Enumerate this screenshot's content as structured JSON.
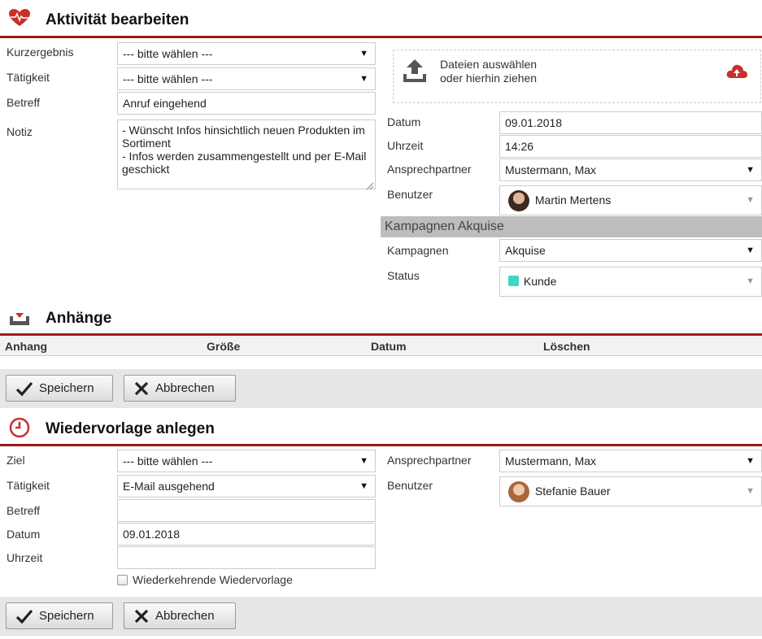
{
  "activity": {
    "title": "Aktivität bearbeiten",
    "labels": {
      "kurzergebnis": "Kurzergebnis",
      "taetigkeit": "Tätigkeit",
      "betreff": "Betreff",
      "notiz": "Notiz",
      "datum": "Datum",
      "uhrzeit": "Uhrzeit",
      "ansprechpartner": "Ansprechpartner",
      "benutzer": "Benutzer",
      "kampagnen": "Kampagnen",
      "status": "Status"
    },
    "values": {
      "kurzergebnis": "--- bitte wählen ---",
      "taetigkeit": "--- bitte wählen ---",
      "betreff": "Anruf eingehend",
      "notiz": "- Wünscht Infos hinsichtlich neuen Produkten im Sortiment\n- Infos werden zusammengestellt und per E-Mail geschickt",
      "datum": "09.01.2018",
      "uhrzeit": "14:26",
      "ansprechpartner": "Mustermann, Max",
      "benutzer": "Martin Mertens",
      "kampagnen": "Akquise",
      "status": "Kunde"
    },
    "upload": {
      "line1": "Dateien auswählen",
      "line2": "oder hierhin ziehen"
    },
    "campaign_header": "Kampagnen Akquise",
    "status_color": "#3ed6c4"
  },
  "attachments": {
    "title": "Anhänge",
    "columns": [
      "Anhang",
      "Größe",
      "Datum",
      "Löschen"
    ]
  },
  "buttons": {
    "save": "Speichern",
    "cancel": "Abbrechen"
  },
  "followup": {
    "title": "Wiedervorlage anlegen",
    "labels": {
      "ziel": "Ziel",
      "taetigkeit": "Tätigkeit",
      "betreff": "Betreff",
      "datum": "Datum",
      "uhrzeit": "Uhrzeit",
      "ansprechpartner": "Ansprechpartner",
      "benutzer": "Benutzer",
      "recurring": "Wiederkehrende Wiedervorlage"
    },
    "values": {
      "ziel": "--- bitte wählen ---",
      "taetigkeit": "E-Mail ausgehend",
      "betreff": "",
      "datum": "09.01.2018",
      "uhrzeit": "",
      "ansprechpartner": "Mustermann, Max",
      "benutzer": "Stefanie Bauer"
    }
  },
  "colors": {
    "accent": "#9b1b1b"
  }
}
